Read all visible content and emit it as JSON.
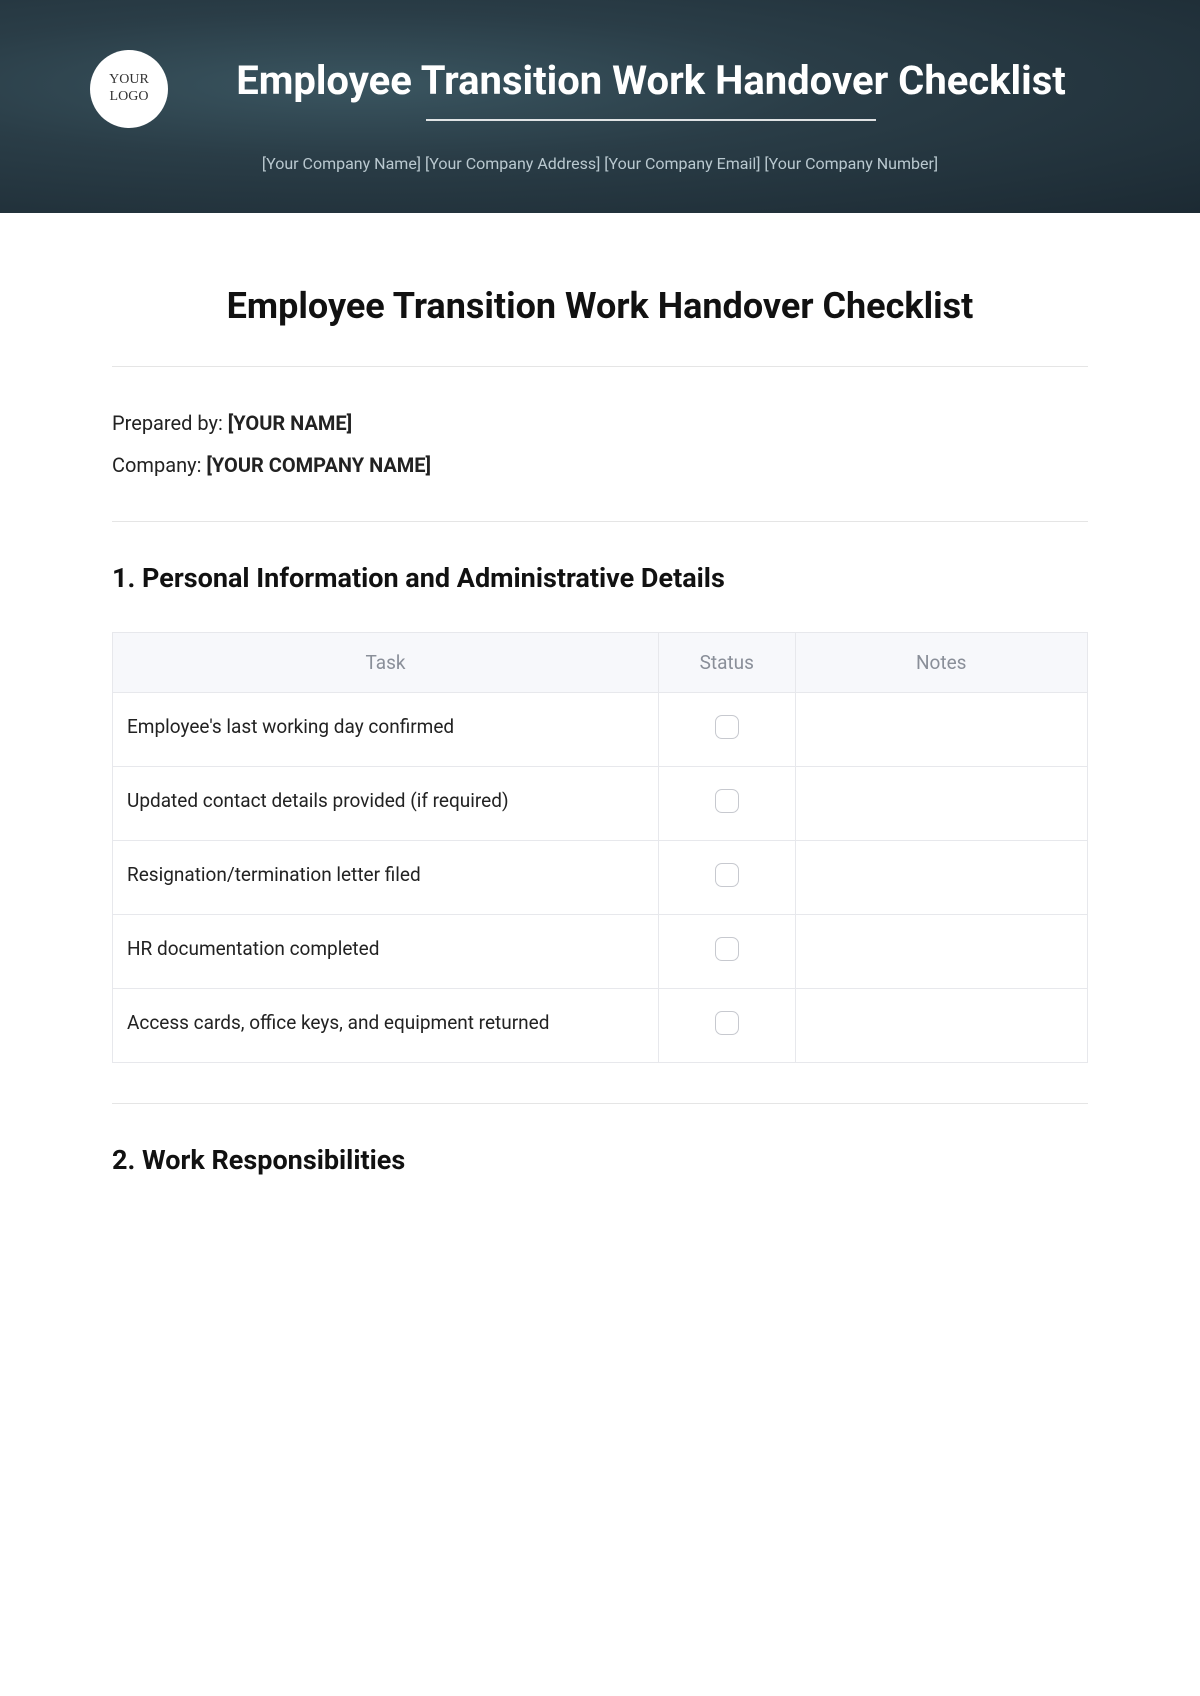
{
  "banner": {
    "logo_line1": "YOUR",
    "logo_line2": "LOGO",
    "title": "Employee Transition Work Handover Checklist",
    "meta": "[Your Company Name] [Your Company Address] [Your Company Email] [Your Company Number]"
  },
  "doc": {
    "title": "Employee Transition Work Handover Checklist",
    "prepared_by_label": "Prepared by: ",
    "prepared_by_value": "[YOUR NAME]",
    "company_label": "Company: ",
    "company_value": "[YOUR COMPANY NAME]"
  },
  "section1": {
    "heading": "1. Personal Information and Administrative Details",
    "columns": {
      "task": "Task",
      "status": "Status",
      "notes": "Notes"
    },
    "rows": [
      {
        "task": "Employee's last working day confirmed",
        "notes": ""
      },
      {
        "task": "Updated contact details provided (if required)",
        "notes": ""
      },
      {
        "task": "Resignation/termination letter filed",
        "notes": ""
      },
      {
        "task": "HR documentation completed",
        "notes": ""
      },
      {
        "task": "Access cards, office keys, and equipment returned",
        "notes": ""
      }
    ]
  },
  "section2": {
    "heading": "2. Work Responsibilities"
  }
}
